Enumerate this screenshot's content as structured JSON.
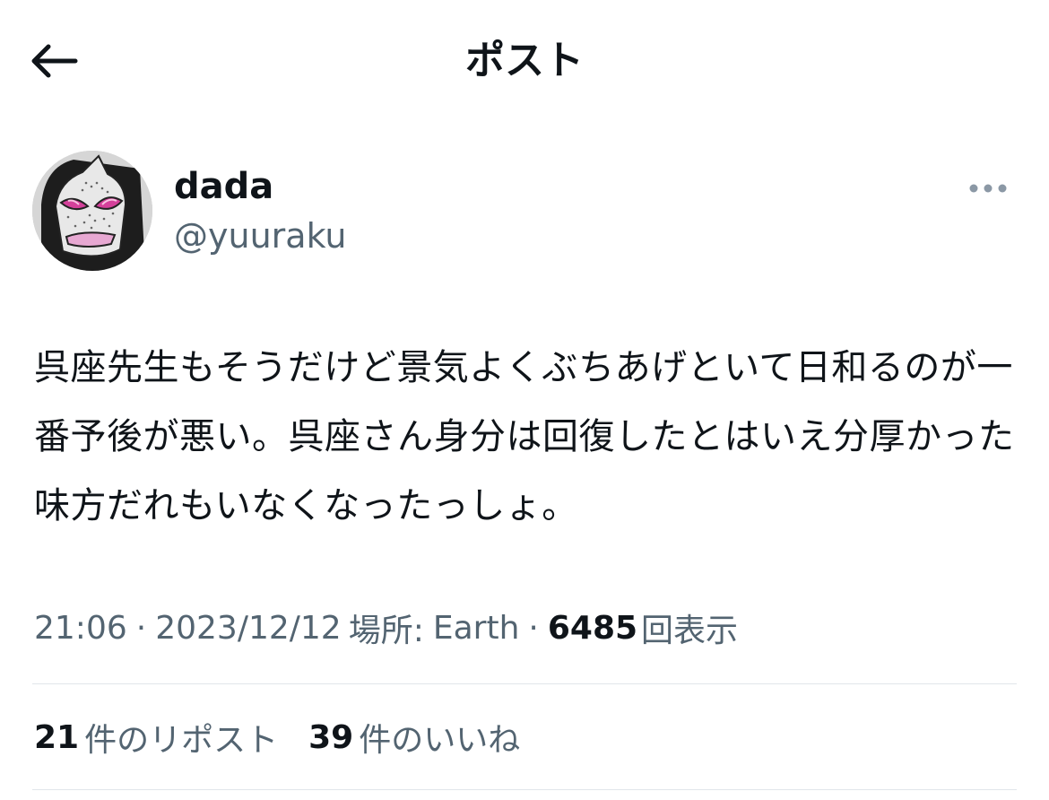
{
  "header": {
    "title": "ポスト",
    "back_icon": "arrow-left-icon"
  },
  "author": {
    "display_name": "dada",
    "handle": "@yuuraku",
    "avatar_icon": "masked-face-avatar",
    "more_icon": "more-horizontal-icon"
  },
  "tweet": {
    "text": "呉座先生もそうだけど景気よくぶちあげといて日和るのが一番予後が悪い。呉座さん身分は回復したとはいえ分厚かった味方だれもいなくなったっしょ。"
  },
  "meta": {
    "time": "21:06",
    "separator": "·",
    "date": "2023/12/12",
    "location_label": "場所:",
    "location_value": "Earth",
    "views_count": "6485",
    "views_label": "回表示"
  },
  "stats": {
    "reposts_count": "21",
    "reposts_label": "件のリポスト",
    "likes_count": "39",
    "likes_label": "件のいいね"
  },
  "colors": {
    "text_primary": "#0f1419",
    "text_secondary": "#536471",
    "divider": "#e1e6ea",
    "avatar_accent": "#d4409a"
  }
}
